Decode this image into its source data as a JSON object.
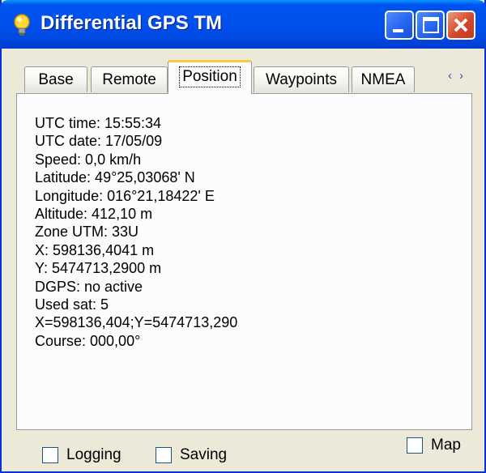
{
  "window": {
    "title": "Differential GPS TM",
    "icon": "lightbulb-icon",
    "controls": [
      "minimize-icon",
      "maximize-icon",
      "close-icon"
    ]
  },
  "tabs": {
    "items": [
      {
        "label": "Base"
      },
      {
        "label": "Remote"
      },
      {
        "label": "Position"
      },
      {
        "label": "Waypoints"
      },
      {
        "label": "NMEA"
      }
    ],
    "active": "Position",
    "scroll_left": "‹",
    "scroll_right": "›"
  },
  "position": {
    "lines": [
      "UTC time: 15:55:34",
      "UTC date: 17/05/09",
      "Speed: 0,0 km/h",
      "Latitude: 49°25,03068' N",
      "Longitude: 016°21,18422' E",
      "Altitude: 412,10 m",
      "Zone UTM: 33U",
      "X: 598136,4041 m",
      "Y: 5474713,2900 m",
      "DGPS: no active",
      "Used sat: 5",
      "X=598136,404;Y=5474713,290",
      "Course: 000,00°"
    ]
  },
  "footer": {
    "logging": {
      "label": "Logging",
      "checked": false
    },
    "saving": {
      "label": "Saving",
      "checked": false
    },
    "map": {
      "label": "Map",
      "checked": false
    }
  },
  "colors": {
    "titlebar": "#0053ee",
    "window_bg": "#ece9d8",
    "panel_bg": "#fcfcfe",
    "active_tab_accent": "#ffc83c",
    "close_button": "#d7462a"
  }
}
